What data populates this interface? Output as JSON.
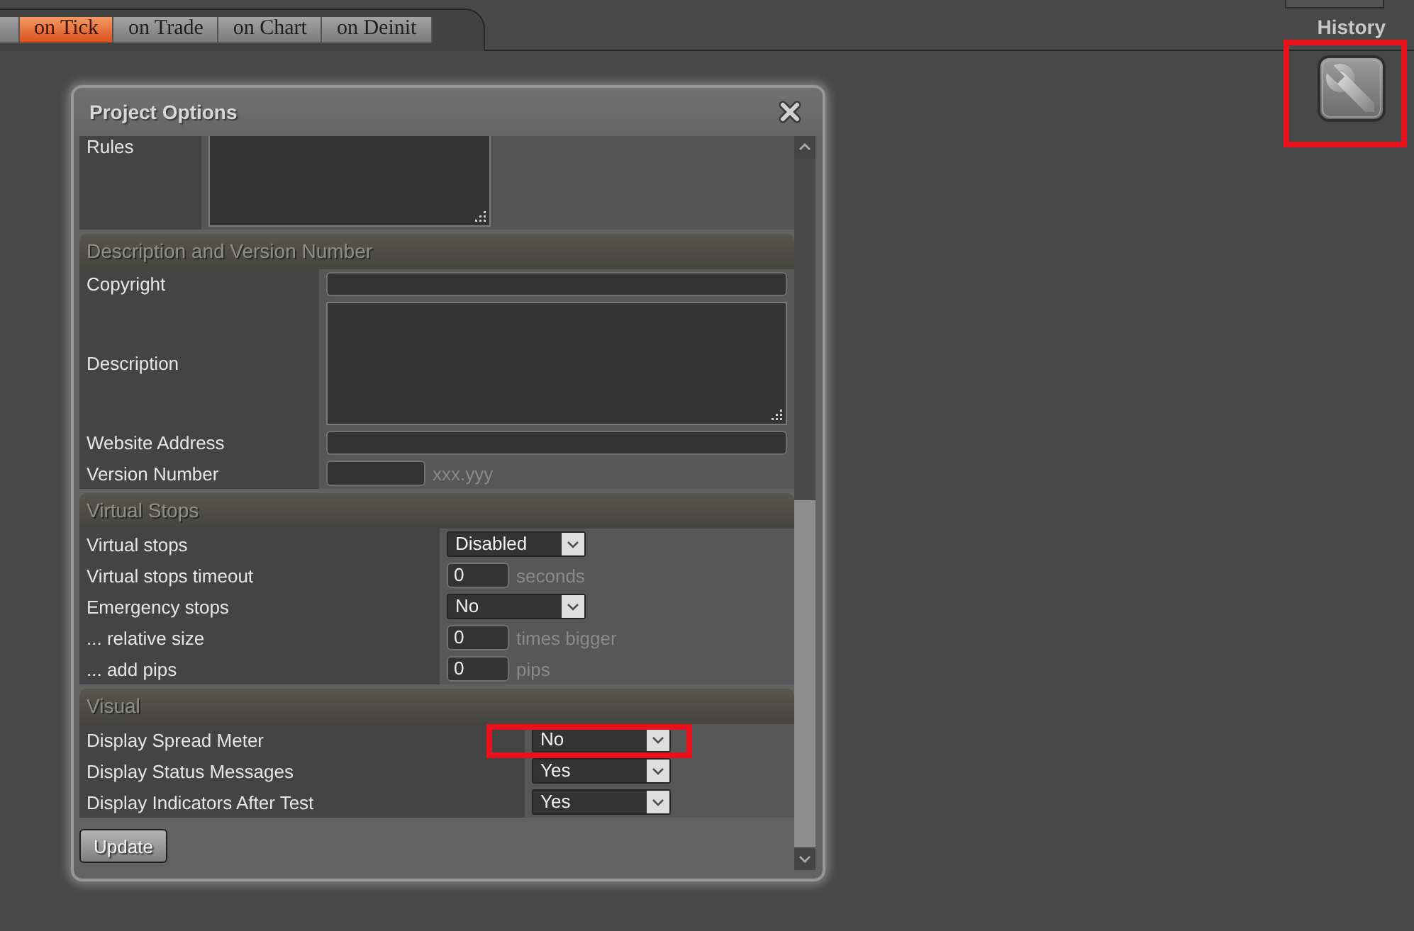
{
  "tabs": [
    {
      "label": "on Tick",
      "selected": true
    },
    {
      "label": "on Trade",
      "selected": false
    },
    {
      "label": "on Chart",
      "selected": false
    },
    {
      "label": "on Deinit",
      "selected": false
    }
  ],
  "toolbar": {
    "label": "History"
  },
  "tool_button": {
    "highlighted": true
  },
  "dialog": {
    "title": "Project Options",
    "rules": {
      "label": "Rules"
    },
    "sections": [
      {
        "title": "Description and Version Number",
        "rows": [
          {
            "kind": "text",
            "label": "Copyright"
          },
          {
            "kind": "textarea",
            "label": "Description"
          },
          {
            "kind": "text",
            "label": "Website Address"
          },
          {
            "kind": "short_text",
            "label": "Version Number",
            "suffix": "xxx.yyy"
          }
        ]
      },
      {
        "title": "Virtual Stops",
        "rows": [
          {
            "kind": "select",
            "label": "Virtual stops",
            "value": "Disabled"
          },
          {
            "kind": "number",
            "label": "Virtual stops timeout",
            "value": "0",
            "suffix": "seconds"
          },
          {
            "kind": "select",
            "label": "Emergency stops",
            "value": "No"
          },
          {
            "kind": "number",
            "label": "... relative size",
            "value": "0",
            "suffix": "times bigger"
          },
          {
            "kind": "number",
            "label": "... add pips",
            "value": "0",
            "suffix": "pips"
          }
        ]
      },
      {
        "title": "Visual",
        "rows": [
          {
            "kind": "select",
            "label": "Display Spread Meter",
            "value": "No",
            "highlighted": true
          },
          {
            "kind": "select",
            "label": "Display Status Messages",
            "value": "Yes",
            "highlighted": false
          },
          {
            "kind": "select",
            "label": "Display Indicators After Test",
            "value": "Yes",
            "highlighted": false
          }
        ]
      }
    ],
    "update_button": "Update"
  }
}
